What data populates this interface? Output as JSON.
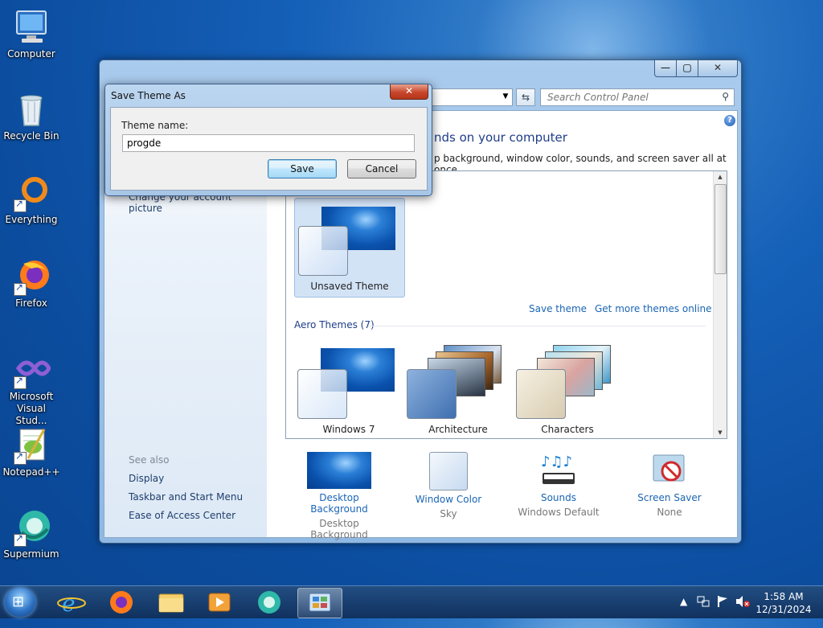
{
  "desktop": {
    "icons": [
      {
        "label": "Computer"
      },
      {
        "label": "Recycle Bin"
      },
      {
        "label": "Everything"
      },
      {
        "label": "Firefox"
      },
      {
        "label": "Microsoft Visual Stud..."
      },
      {
        "label": "Notepad++"
      },
      {
        "label": "Supermium"
      }
    ]
  },
  "control_panel": {
    "search_placeholder": "Search Control Panel",
    "heading": "nds on your computer",
    "subheading": "p background, window color, sounds, and screen saver all at once.",
    "left": {
      "change_picture": "Change your account picture",
      "see_also": "See also",
      "links": [
        "Display",
        "Taskbar and Start Menu",
        "Ease of Access Center"
      ]
    },
    "themes": {
      "unsaved_label": "Unsaved Theme",
      "save_theme": "Save theme",
      "get_more": "Get more themes online",
      "aero_title": "Aero Themes (7)",
      "aero": [
        "Windows 7",
        "Architecture",
        "Characters"
      ]
    },
    "bottom": [
      {
        "link": "Desktop Background",
        "sub": "Desktop Background"
      },
      {
        "link": "Window Color",
        "sub": "Sky"
      },
      {
        "link": "Sounds",
        "sub": "Windows Default"
      },
      {
        "link": "Screen Saver",
        "sub": "None"
      }
    ]
  },
  "dialog": {
    "title": "Save Theme As",
    "label": "Theme name:",
    "value": "progde",
    "save": "Save",
    "cancel": "Cancel",
    "close": "✕"
  },
  "taskbar": {
    "time": "1:58 AM",
    "date": "12/31/2024"
  },
  "colors": {
    "link": "#1a65b5",
    "heading": "#1e3d8a"
  }
}
